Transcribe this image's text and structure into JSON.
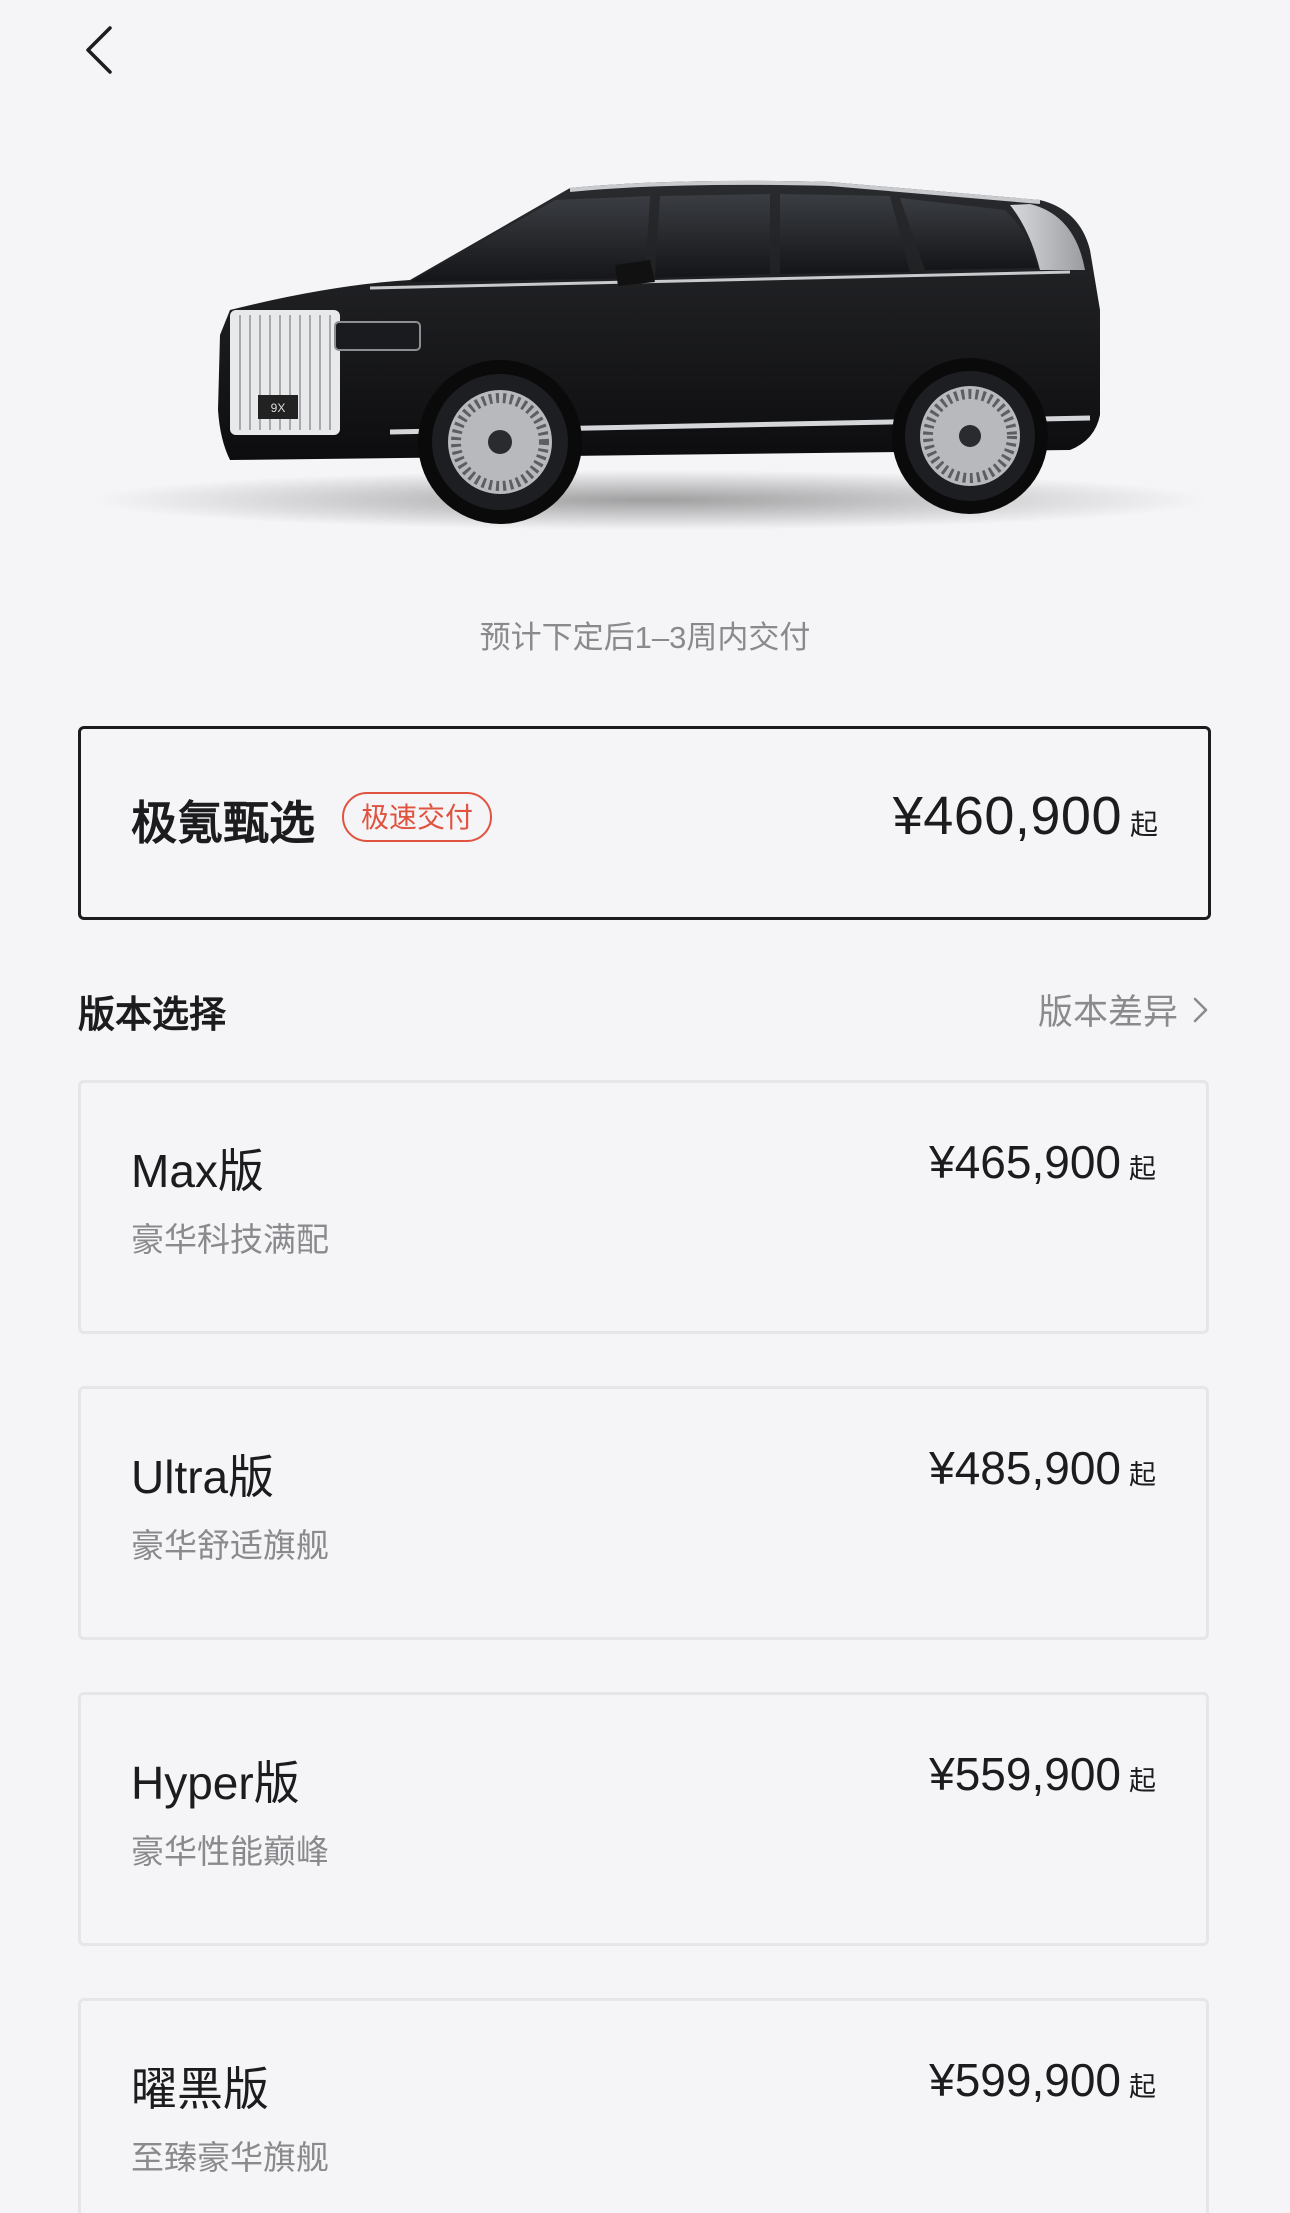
{
  "header": {
    "back_icon": "chevron-left-icon"
  },
  "hero": {
    "plate_text": "9X",
    "delivery_note": "预计下定后1–3周内交付"
  },
  "featured": {
    "title": "极氪甄选",
    "badge": "极速交付",
    "price": "¥460,900",
    "price_suffix": "起"
  },
  "versions_section": {
    "title": "版本选择",
    "compare_label": "版本差异",
    "compare_icon": "chevron-right-icon"
  },
  "versions": [
    {
      "name": "Max版",
      "desc": "豪华科技满配",
      "price": "¥465,900",
      "suffix": "起"
    },
    {
      "name": "Ultra版",
      "desc": "豪华舒适旗舰",
      "price": "¥485,900",
      "suffix": "起"
    },
    {
      "name": "Hyper版",
      "desc": "豪华性能巅峰",
      "price": "¥559,900",
      "suffix": "起"
    },
    {
      "name": "曜黑版",
      "desc": "至臻豪华旗舰",
      "price": "¥599,900",
      "suffix": "起"
    }
  ],
  "colors": {
    "accent": "#e0533f",
    "text": "#1c1c1e",
    "muted": "#8a8a8e",
    "background": "#f5f5f7"
  }
}
